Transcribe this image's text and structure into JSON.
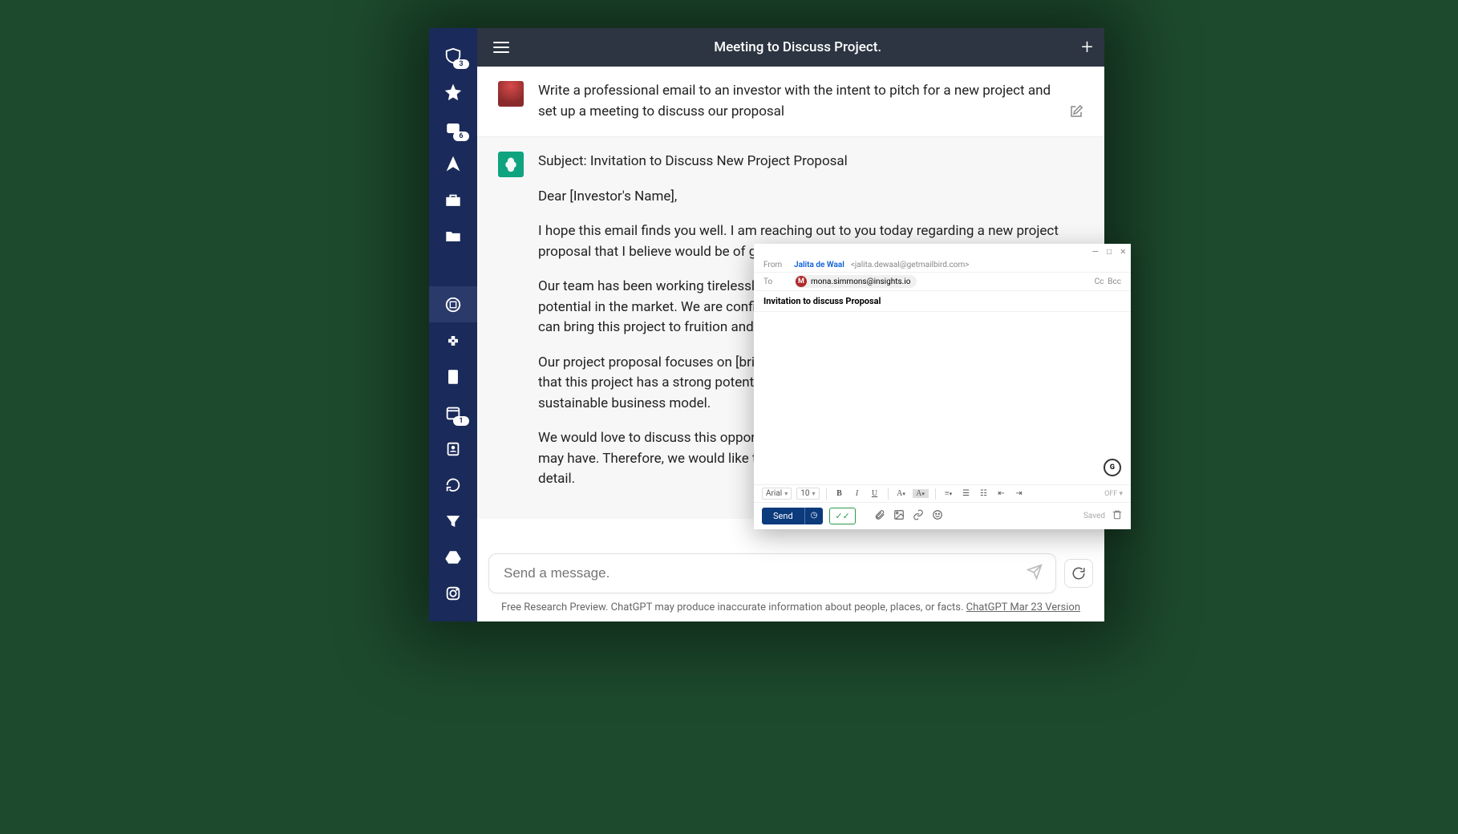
{
  "sidebar": {
    "inbox_badge": "3",
    "attachments_badge": "6",
    "calendar_badge": "1"
  },
  "header": {
    "title": "Meeting to Discuss Project."
  },
  "chat": {
    "user_message": "Write a professional email to an investor with the intent to pitch for a new project and set up a meeting to discuss our proposal",
    "assistant_paragraphs": [
      "Subject: Invitation to Discuss New Project Proposal",
      "Dear [Investor's Name],",
      "I hope this email finds you well. I am reaching out to you today regarding a new project proposal that I believe would be of great interest to you.",
      "Our team has been working tirelessly to develop a project that we believe has tremendous potential in the market. We are confident that with the right investment and support, we can bring this project to fruition and make a significant impact.",
      "Our project proposal focuses on [brief description of the project and its goals]. We believe that this project has a strong potential to generate significant returns and create a sustainable business model.",
      "We would love to discuss this opportunity with you further and answer any questions you may have. Therefore, we would like to invite you to a meeting to discuss our project in detail."
    ]
  },
  "input": {
    "placeholder": "Send a message."
  },
  "footer": {
    "note_prefix": "Free Research Preview. ChatGPT may produce inaccurate information about people, places, or facts. ",
    "version_link": "ChatGPT Mar 23 Version"
  },
  "compose": {
    "from_label": "From",
    "from_name": "Jalita de Waal",
    "from_email": "<jalita.dewaal@getmailbird.com>",
    "to_label": "To",
    "to_email": "mona.simmons@insights.io",
    "to_initial": "M",
    "cc": "Cc",
    "bcc": "Bcc",
    "subject": "Invitation to discuss Proposal",
    "font_family": "Arial",
    "font_size": "10",
    "off_label": "OFF",
    "send_label": "Send",
    "saved_label": "Saved"
  }
}
